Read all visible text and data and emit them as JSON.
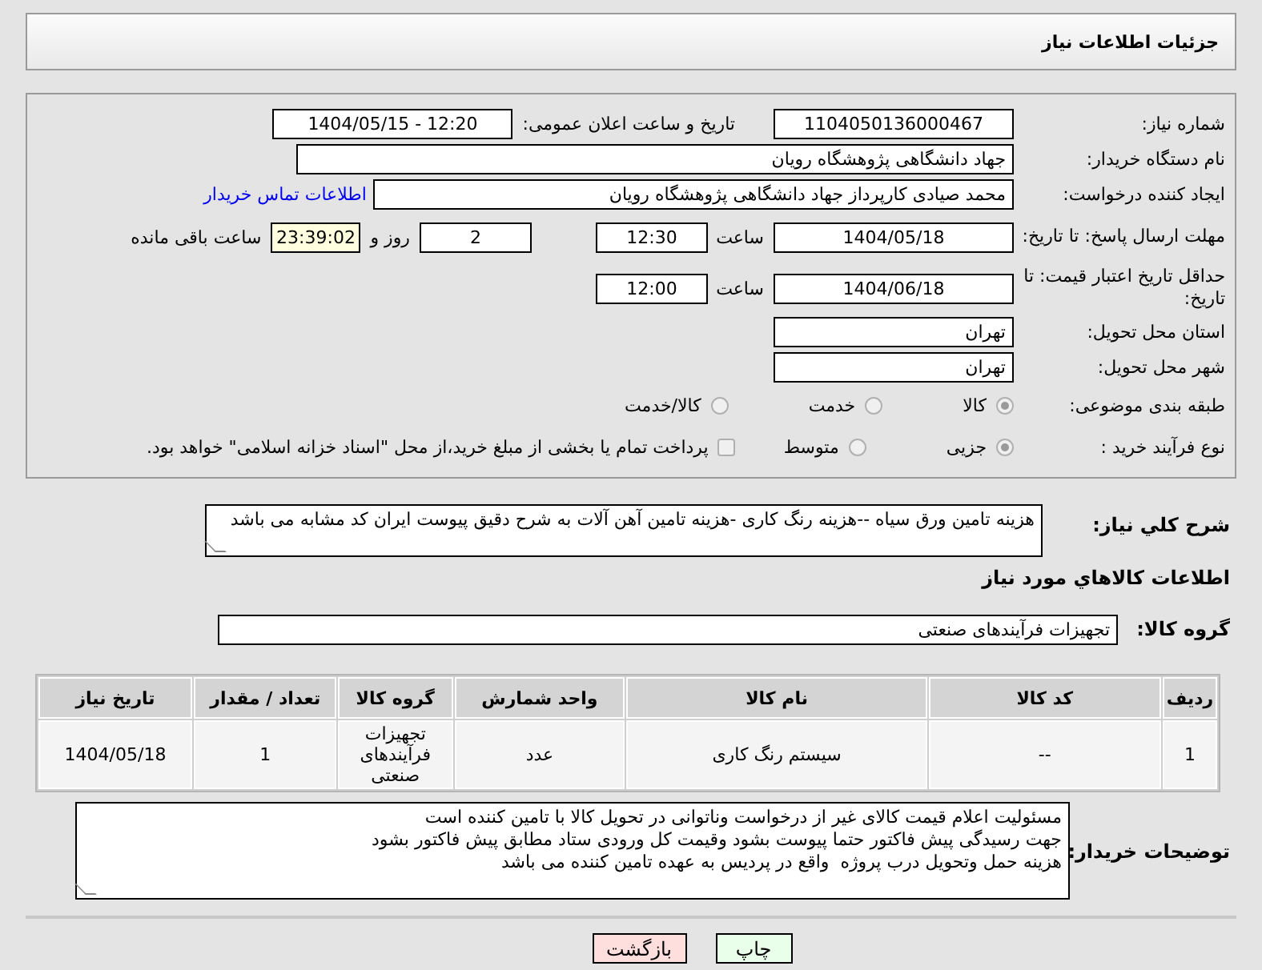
{
  "header": {
    "title": "جزئیات اطلاعات نیاز"
  },
  "need_number": {
    "label": "شماره نیاز:",
    "value": "1104050136000467"
  },
  "announcement": {
    "label": "تاریخ و ساعت اعلان عمومی:",
    "value": "1404/05/15 - 12:20"
  },
  "buyer_org": {
    "label": "نام دستگاه خریدار:",
    "value": "جهاد دانشگاهی پژوهشگاه رویان"
  },
  "requester": {
    "label": "ایجاد کننده درخواست:",
    "value": "محمد صیادی کارپرداز جهاد دانشگاهی پژوهشگاه رویان",
    "link": "اطلاعات تماس خریدار"
  },
  "response_deadline": {
    "label": "مهلت ارسال پاسخ: تا تاریخ:",
    "date": "1404/05/18",
    "time_label": "ساعت",
    "time": "12:30",
    "days": "2",
    "days_label": "روز و",
    "remaining": "23:39:02",
    "remaining_label": "ساعت باقی مانده"
  },
  "price_validity": {
    "label": "حداقل تاریخ اعتبار قیمت: تا تاریخ:",
    "date": "1404/06/18",
    "time_label": "ساعت",
    "time": "12:00"
  },
  "province": {
    "label": "استان محل تحویل:",
    "value": "تهران"
  },
  "city": {
    "label": "شهر محل تحویل:",
    "value": "تهران"
  },
  "category": {
    "label": "طبقه بندی موضوعی:",
    "options": [
      {
        "label": "کالا",
        "selected": true
      },
      {
        "label": "خدمت",
        "selected": false
      },
      {
        "label": "کالا/خدمت",
        "selected": false
      }
    ]
  },
  "process": {
    "label": "نوع فرآیند خرید :",
    "options": [
      {
        "label": "جزیی",
        "selected": true
      },
      {
        "label": "متوسط",
        "selected": false
      }
    ],
    "treasury": {
      "label": "پرداخت تمام یا بخشی از مبلغ خرید،از محل \"اسناد خزانه اسلامی\" خواهد بود.",
      "checked": false
    }
  },
  "description": {
    "label": "شرح کلي نياز:",
    "value": "هزینه تامین ورق سیاه --هزینه رنگ کاری -هزینه تامین آهن آلات به شرح دقیق پیوست ایران کد مشابه می باشد"
  },
  "goods_heading": "اطلاعات كالاهاي مورد نياز",
  "goods_group": {
    "label": "گروه کالا:",
    "value": "تجهیزات فرآیندهای صنعتی"
  },
  "table": {
    "columns": [
      "ردیف",
      "کد کالا",
      "نام کالا",
      "واحد شمارش",
      "گروه کالا",
      "تعداد / مقدار",
      "تاریخ نیاز"
    ],
    "rows": [
      [
        "1",
        "--",
        "سیستم رنگ کاری",
        "عدد",
        "تجهیزات فرآیندهای صنعتی",
        "1",
        "1404/05/18"
      ]
    ]
  },
  "buyer_notes": {
    "label": "توضیحات خریدار:",
    "value": "مسئولیت اعلام قیمت کالای غیر از درخواست وناتوانی در تحویل کالا با تامین کننده است\nجهت رسیدگی پیش فاکتور حتما پیوست بشود وقیمت کل ورودی ستاد مطابق پیش فاکتور بشود\nهزینه حمل وتحویل درب پروژه  واقع در پردیس به عهده تامین کننده می باشد"
  },
  "buttons": [
    {
      "label": "چاپ",
      "kind": "print"
    },
    {
      "label": "بازگشت",
      "kind": "back"
    }
  ]
}
